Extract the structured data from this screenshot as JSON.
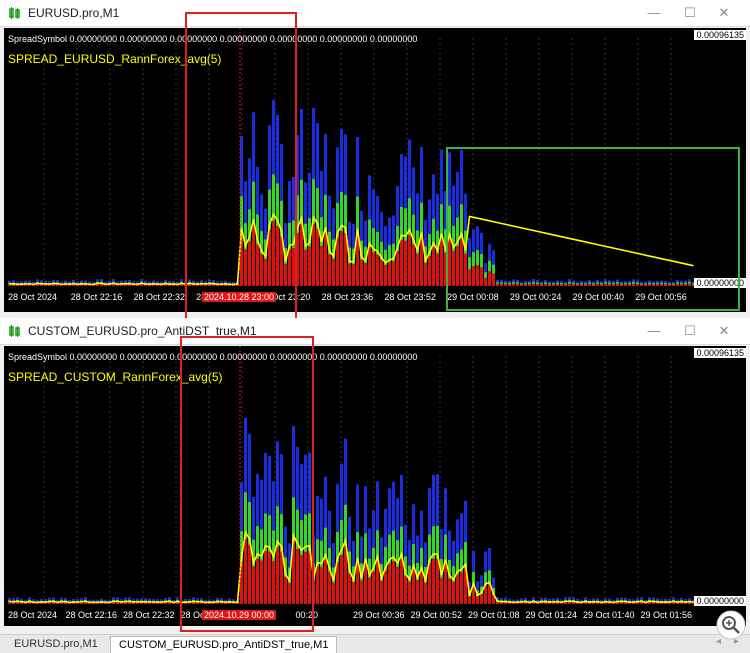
{
  "window1": {
    "title": "EURUSD.pro,M1",
    "symbol_line": "SpreadSymbol 0.00000000 0.00000000 0.00000000 0.00000000 0.00000000 0.00000000 0.00000000",
    "indicator": "SPREAD_EURUSD_RannForex_avg(5)",
    "price_top": "0.00096135",
    "price_bottom": "0.00000000",
    "x_labels": [
      "28 Oct 2024",
      "28 Oct 22:16",
      "28 Oct 22:32",
      "28 Oct 23:04",
      "28 Oct 23:20",
      "28 Oct 23:36",
      "28 Oct 23:52",
      "29 Oct 00:08",
      "29 Oct 00:24",
      "29 Oct 00:40",
      "29 Oct 00:56"
    ],
    "cursor_label": "2024.10.28 23:00"
  },
  "window2": {
    "title": "CUSTOM_EURUSD.pro_AntiDST_true,M1",
    "symbol_line": "SpreadSymbol 0.00000000 0.00000000 0.00000000 0.00000000 0.00000000 0.00000000 0.00000000",
    "indicator": "SPREAD_CUSTOM_RannForex_avg(5)",
    "price_top": "0.00096135",
    "price_bottom": "0.00000000",
    "x_labels": [
      "28 Oct 2024",
      "28 Oct 22:16",
      "28 Oct 22:32",
      "28 Oct 23:48",
      "00:04",
      "00:20",
      "29 Oct 00:36",
      "29 Oct 00:52",
      "29 Oct 01:08",
      "29 Oct 01:24",
      "29 Oct 01:40",
      "29 Oct 01:56"
    ],
    "cursor_label": "2024.10.29 00:00"
  },
  "window_buttons": {
    "minimize": "—",
    "maximize": "☐",
    "close": "✕"
  },
  "tabs": [
    "EURUSD.pro,M1",
    "CUSTOM_EURUSD.pro_AntiDST_true,M1"
  ],
  "tab_arrows": {
    "left": "◂",
    "right": "▸"
  },
  "colors": {
    "red_bars": "#e01010",
    "green_bars": "#33d62a",
    "blue_bars": "#1a2ee0",
    "avg_line": "#ffff00",
    "annotation_red": "#e02020",
    "annotation_green": "#3cb043"
  }
}
